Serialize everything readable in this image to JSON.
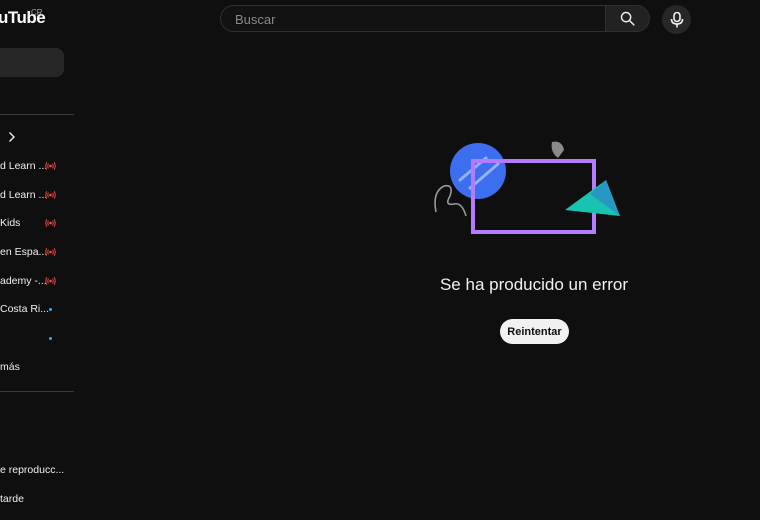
{
  "header": {
    "logo_text": "uTube",
    "country_code": "CR",
    "search": {
      "placeholder": "Buscar"
    }
  },
  "sidebar": {
    "subscriptions": [
      {
        "label": "d Learn ...",
        "status": "live"
      },
      {
        "label": "d Learn ...",
        "status": "live"
      },
      {
        "label": "Kids",
        "status": "live"
      },
      {
        "label": "en Espa...",
        "status": "live"
      },
      {
        "label": "ademy -...",
        "status": "live"
      },
      {
        "label": "Costa Ri...",
        "status": "new"
      },
      {
        "label": "",
        "status": "new"
      }
    ],
    "show_more_label": "más",
    "you_items": [
      {
        "label": "e reproducc..."
      },
      {
        "label": "tarde"
      }
    ]
  },
  "main": {
    "error_message": "Se ha producido un error",
    "retry_label": "Reintentar"
  },
  "colors": {
    "background": "#0f0f0f",
    "live_red": "#ff4e45",
    "new_dot_blue": "#3ea6ff",
    "illustration_blue": "#3d6ef0",
    "illustration_purple": "#b57bff",
    "illustration_teal": "#19c3b0"
  }
}
